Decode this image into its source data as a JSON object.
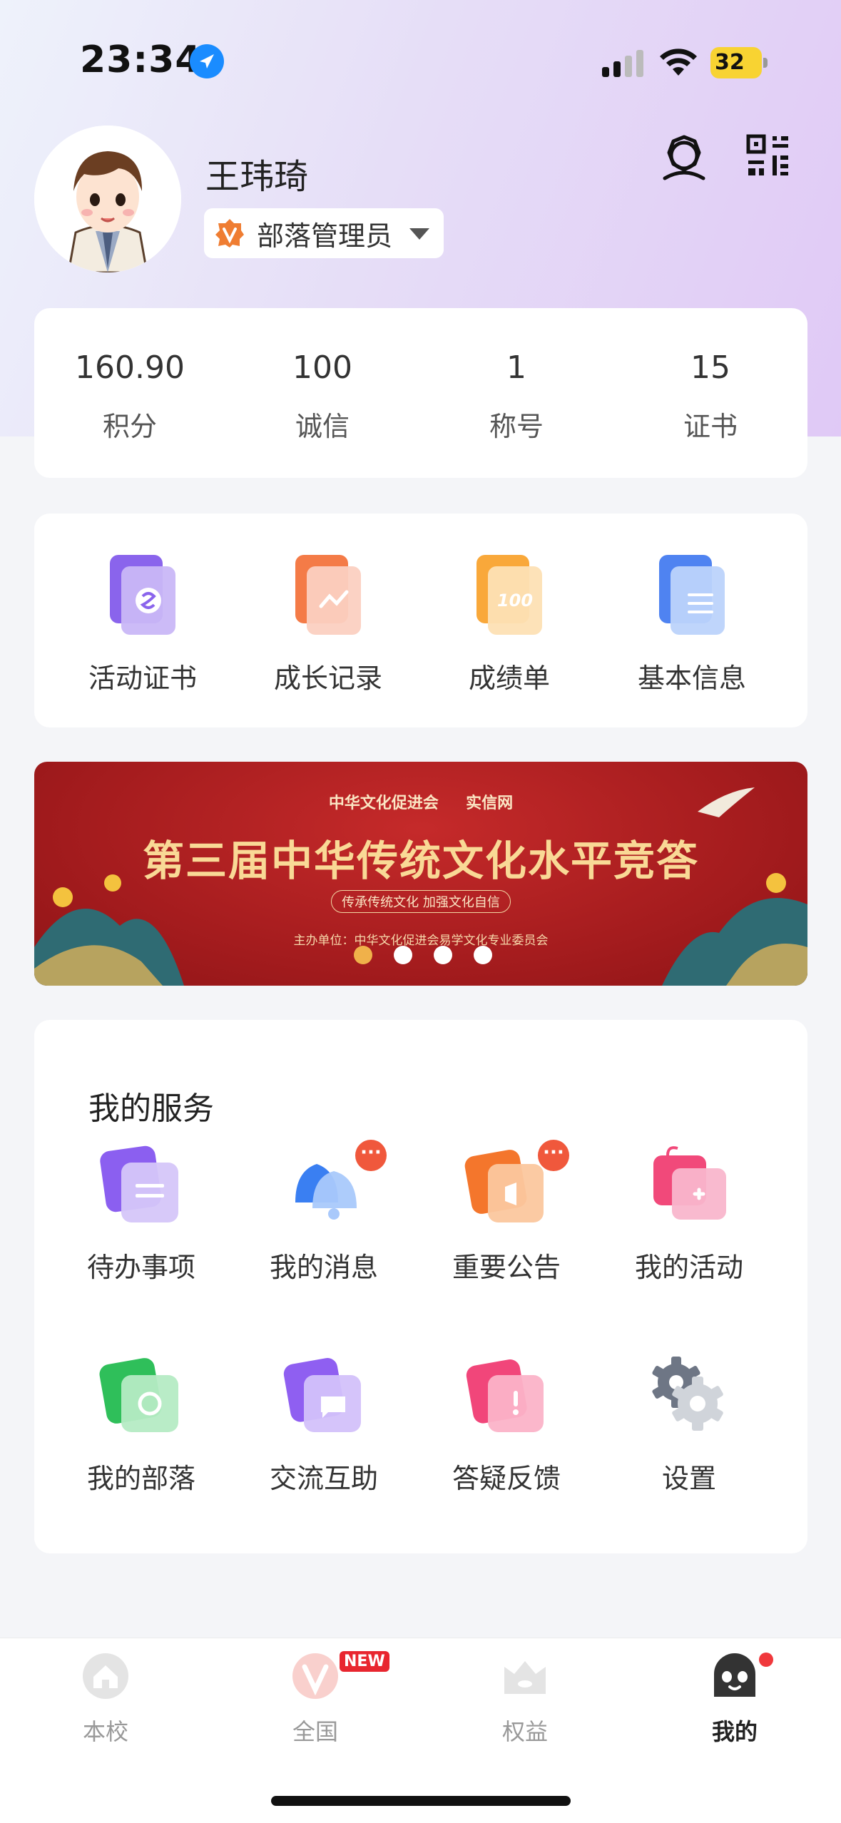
{
  "status_bar": {
    "time": "23:34",
    "battery": "32"
  },
  "profile": {
    "name": "王玮琦",
    "role": "部落管理员"
  },
  "stats": [
    {
      "value": "160.90",
      "label": "积分"
    },
    {
      "value": "100",
      "label": "诚信"
    },
    {
      "value": "1",
      "label": "称号"
    },
    {
      "value": "15",
      "label": "证书"
    }
  ],
  "quick_links": [
    {
      "label": "活动证书",
      "icon": "certificate-icon"
    },
    {
      "label": "成长记录",
      "icon": "growth-chart-icon"
    },
    {
      "label": "成绩单",
      "icon": "score-card-icon"
    },
    {
      "label": "基本信息",
      "icon": "document-icon"
    }
  ],
  "banner": {
    "logo_left": "中华文化促进会",
    "logo_right": "实信网",
    "title": "第三届中华传统文化水平竞答",
    "subtitle": "传承传统文化 加强文化自信",
    "organizer": "主办单位：中华文化促进会易学文化专业委员会",
    "page_count": 4,
    "active_page": 1
  },
  "services": {
    "title": "我的服务",
    "items": [
      {
        "label": "待办事项",
        "icon": "todo-icon"
      },
      {
        "label": "我的消息",
        "icon": "bell-icon",
        "more_badge": "···"
      },
      {
        "label": "重要公告",
        "icon": "announcement-icon",
        "more_badge": "···"
      },
      {
        "label": "我的活动",
        "icon": "activity-icon"
      },
      {
        "label": "我的部落",
        "icon": "tribe-icon"
      },
      {
        "label": "交流互助",
        "icon": "chat-icon"
      },
      {
        "label": "答疑反馈",
        "icon": "feedback-icon"
      },
      {
        "label": "设置",
        "icon": "gear-icon"
      }
    ]
  },
  "tabs": [
    {
      "label": "本校",
      "icon": "school-icon"
    },
    {
      "label": "全国",
      "icon": "national-icon",
      "tag": "NEW"
    },
    {
      "label": "权益",
      "icon": "crown-icon"
    },
    {
      "label": "我的",
      "icon": "profile-icon"
    }
  ],
  "active_tab": "我的",
  "colors": {
    "accent_orange": "#f0583c",
    "banner_red": "#a51c1e",
    "active_dot": "#f0b14a"
  }
}
